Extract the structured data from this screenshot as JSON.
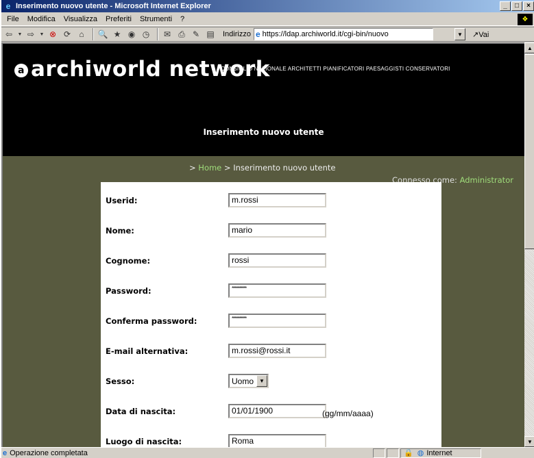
{
  "window": {
    "title": "Inserimento nuovo utente - Microsoft Internet Explorer"
  },
  "menu": [
    "File",
    "Modifica",
    "Visualizza",
    "Preferiti",
    "Strumenti",
    "?"
  ],
  "toolbar": {
    "address_label": "Indirizzo",
    "url": "https://ldap.archiworld.it/cgi-bin/nuovo",
    "go_label": "Vai"
  },
  "site": {
    "logo": "archiworld network",
    "tagline": "CONSIGLIO NAZIONALE ARCHITETTI PIANIFICATORI PAESAGGISTI CONSERVATORI",
    "page_heading": "Inserimento nuovo utente",
    "breadcrumb": {
      "prefix": "> ",
      "home": "Home",
      "current": " > Inserimento nuovo utente"
    },
    "connected": {
      "label": "Connesso come: ",
      "user": "Administrator"
    }
  },
  "form": {
    "userid": {
      "label": "Userid:",
      "value": "m.rossi"
    },
    "nome": {
      "label": "Nome:",
      "value": "mario"
    },
    "cognome": {
      "label": "Cognome:",
      "value": "rossi"
    },
    "password": {
      "label": "Password:",
      "value": "**********"
    },
    "conferma": {
      "label": "Conferma password:",
      "value": "**********"
    },
    "email": {
      "label": "E-mail alternativa:",
      "value": "m.rossi@rossi.it"
    },
    "sesso": {
      "label": "Sesso:",
      "value": "Uomo"
    },
    "data_nascita": {
      "label": "Data di nascita:",
      "value": "01/01/1900",
      "hint": "(gg/mm/aaaa)"
    },
    "luogo_nascita": {
      "label": "Luogo di nascita:",
      "value": "Roma"
    }
  },
  "status": {
    "text": "Operazione completata",
    "zone": "Internet"
  }
}
